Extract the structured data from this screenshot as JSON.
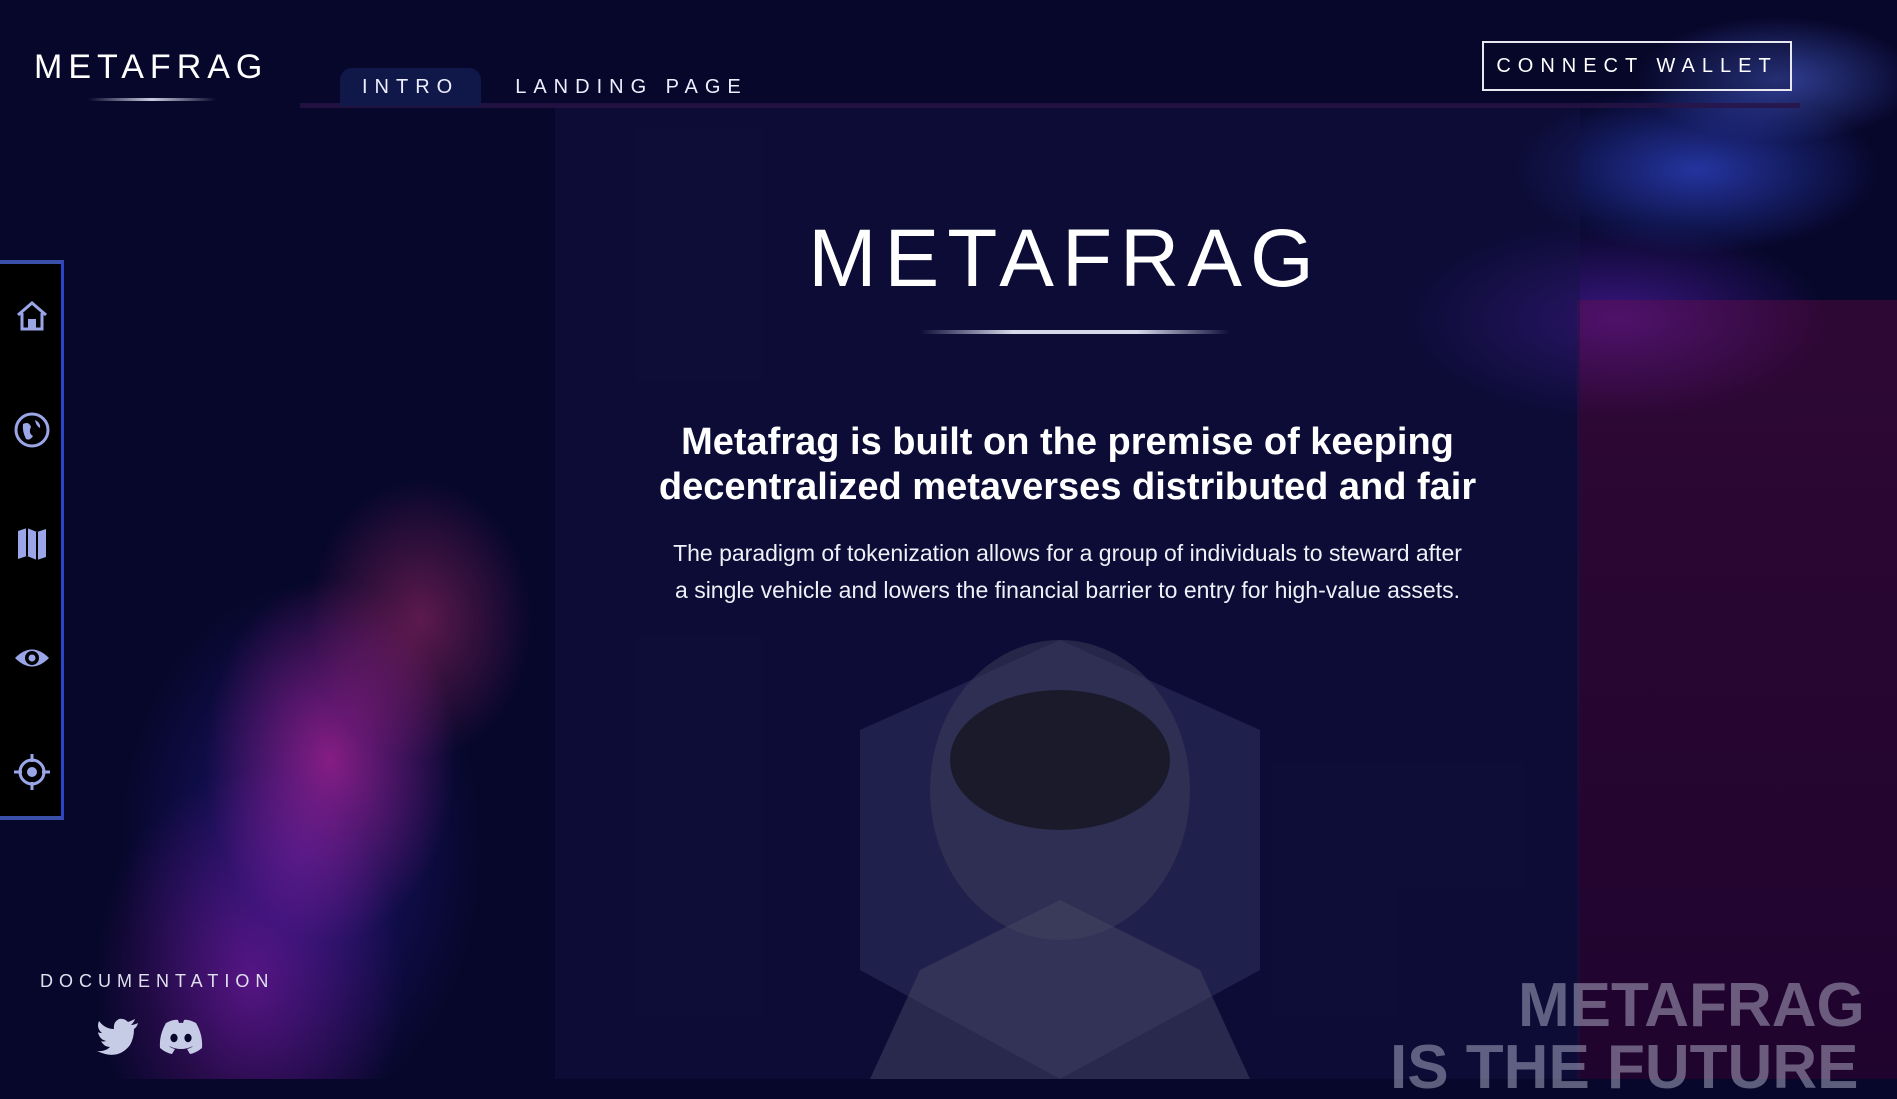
{
  "brand": {
    "logo": "METAFRAG"
  },
  "tabs": [
    {
      "label": "INTRO",
      "active": true
    },
    {
      "label": "LANDING PAGE",
      "active": false
    }
  ],
  "header": {
    "connect_label": "CONNECT WALLET"
  },
  "sidebar": {
    "items": [
      {
        "icon": "home-icon"
      },
      {
        "icon": "globe-icon"
      },
      {
        "icon": "map-icon"
      },
      {
        "icon": "eye-icon"
      },
      {
        "icon": "crosshair-icon"
      }
    ]
  },
  "footer": {
    "documentation_label": "DOCUMENTATION",
    "social": [
      {
        "icon": "twitter-icon"
      },
      {
        "icon": "discord-icon"
      }
    ]
  },
  "hero": {
    "logo": "METAFRAG",
    "headline": "Metafrag is built on the premise of keeping decentralized metaverses distributed and fair",
    "paragraph": "The paradigm of tokenization allows for a group of individuals to steward after a single vehicle and lowers the financial barrier to entry for high-value assets.",
    "bottom_line1": "METAFRAG",
    "bottom_line2": "IS THE FUTURE"
  },
  "colors": {
    "background": "#07072b",
    "sidebar_accent": "#2a46c8",
    "active_tab": "#10184a"
  }
}
